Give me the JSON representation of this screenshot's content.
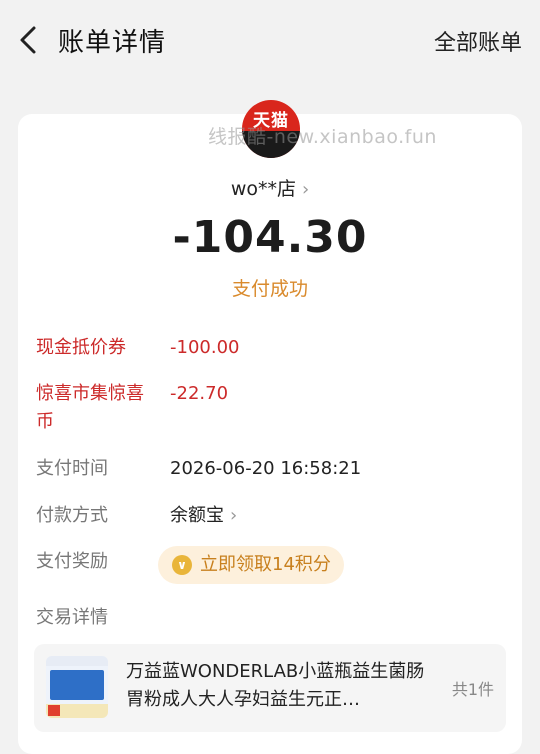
{
  "header": {
    "title": "账单详情",
    "all_bills": "全部账单"
  },
  "merchant": {
    "logo_text": "天猫",
    "watermark": "线报酷-new.xianbao.fun",
    "store_name": "wo**店"
  },
  "payment": {
    "amount": "-104.30",
    "status": "支付成功"
  },
  "details": [
    {
      "label": "现金抵价券",
      "value": "-100.00"
    },
    {
      "label_line1": "惊喜市集惊喜",
      "label_line2": "币",
      "value": "-22.70"
    },
    {
      "label": "支付时间",
      "value": "2026-06-20 16:58:21"
    },
    {
      "label": "付款方式",
      "value": "余额宝"
    },
    {
      "label": "支付奖励",
      "value": "立即领取14积分"
    }
  ],
  "trade": {
    "label": "交易详情",
    "product_title": "万益蓝WONDERLAB小蓝瓶益生菌肠胃粉成人大人孕妇益生元正…",
    "count": "共1件"
  },
  "colors": {
    "accent_red": "#cc2a2a",
    "status_orange": "#d98a2c",
    "logo_red": "#d9261c",
    "reward_bg": "#fdf0dc"
  }
}
